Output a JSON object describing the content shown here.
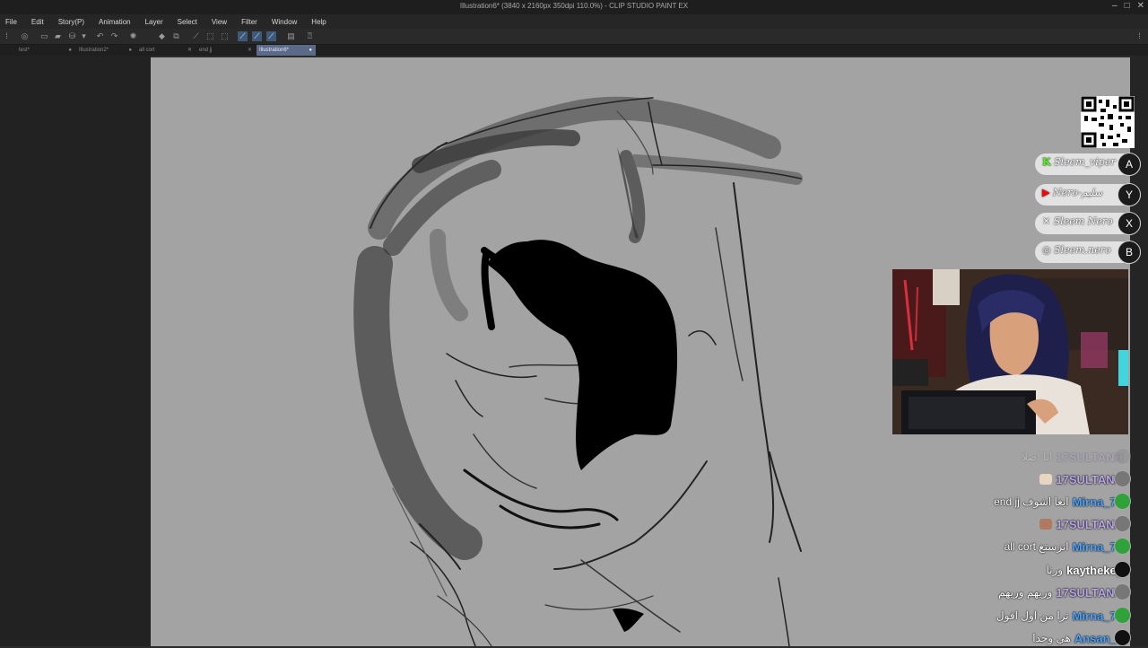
{
  "window": {
    "title": "Illustration6* (3840 x 2160px 350dpi 110.0%) - CLIP STUDIO PAINT EX",
    "controls": [
      "–",
      "□",
      "✕"
    ]
  },
  "menu": [
    "File",
    "Edit",
    "Story(P)",
    "Animation",
    "Layer",
    "Select",
    "View",
    "Filter",
    "Window",
    "Help"
  ],
  "tabs": [
    {
      "label": "test*",
      "mark": "●"
    },
    {
      "label": "Illustration2*",
      "mark": "●"
    },
    {
      "label": "all cort",
      "mark": "✕"
    },
    {
      "label": "end jj",
      "mark": "✕"
    },
    {
      "label": "Illustration6*",
      "mark": "●"
    }
  ],
  "overlay": {
    "socials": [
      {
        "handle": "Sleem_viper",
        "badge": "A",
        "icon": "kick-icon",
        "accent": "#53fc18"
      },
      {
        "handle": "Nero-سليم",
        "badge": "Y",
        "icon": "youtube-icon",
        "accent": "#ff0000"
      },
      {
        "handle": "Sleem Nero",
        "badge": "X",
        "icon": "x-icon",
        "accent": "#ffffff"
      },
      {
        "handle": "Sleem.nero",
        "badge": "B",
        "icon": "instagram-icon",
        "accent": "#e1306c"
      }
    ]
  },
  "chat": [
    {
      "msg": "انا اصلا",
      "user": "17SULTANH",
      "color": "#b9a6e8",
      "faded": true
    },
    {
      "msg": "",
      "user": "17SULTANH",
      "color": "#b9a6e8",
      "emote": "#e8d6c0"
    },
    {
      "msg": "end jj ابغا اشوف",
      "user": "Mirna_77",
      "color": "#4aa3ff"
    },
    {
      "msg": "",
      "user": "17SULTANH",
      "color": "#b9a6e8",
      "emote": "#b07a60"
    },
    {
      "msg": "all cort انزستغ",
      "user": "Mirna_77",
      "color": "#4aa3ff"
    },
    {
      "msg": "ورنا",
      "user": "kaythekey",
      "color": "#ffffff"
    },
    {
      "msg": "وريهم وريهم",
      "user": "17SULTANH",
      "color": "#b9a6e8"
    },
    {
      "msg": "ترا من اول اقول",
      "user": "Mirna_77",
      "color": "#4aa3ff"
    },
    {
      "msg": "هي وحدا",
      "user": "Ansan_7",
      "color": "#4aa3ff"
    }
  ]
}
